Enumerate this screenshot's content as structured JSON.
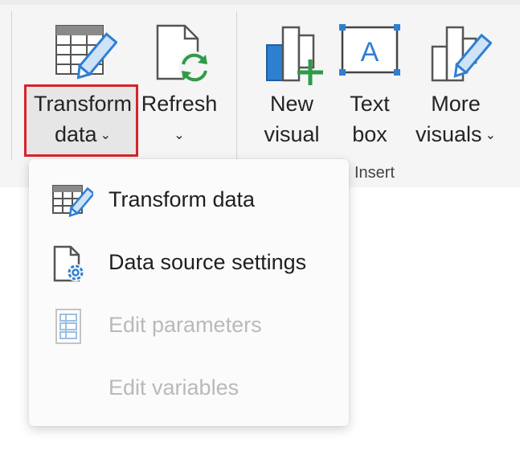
{
  "ribbon": {
    "transform": {
      "line1": "Transform",
      "line2": "data",
      "chevron": "⌄"
    },
    "refresh": {
      "line1": "Refresh",
      "chevron": "⌄"
    },
    "new_visual": {
      "line1": "New",
      "line2": "visual"
    },
    "text_box": {
      "line1": "Text",
      "line2": "box"
    },
    "more_visuals": {
      "line1": "More",
      "line2": "visuals",
      "chevron": "⌄"
    },
    "insert_group_label": "Insert"
  },
  "menu": {
    "items": [
      {
        "label": "Transform data",
        "icon": "transform-data-icon",
        "enabled": true
      },
      {
        "label": "Data source settings",
        "icon": "data-source-settings-icon",
        "enabled": true
      },
      {
        "label": "Edit parameters",
        "icon": "edit-parameters-icon",
        "enabled": false
      },
      {
        "label": "Edit variables",
        "icon": "",
        "enabled": false
      }
    ]
  },
  "colors": {
    "highlight_border": "#d6232c",
    "accent_blue": "#2f7fd1",
    "accent_green": "#2e9b47",
    "disabled_text": "#b9b9b9"
  }
}
